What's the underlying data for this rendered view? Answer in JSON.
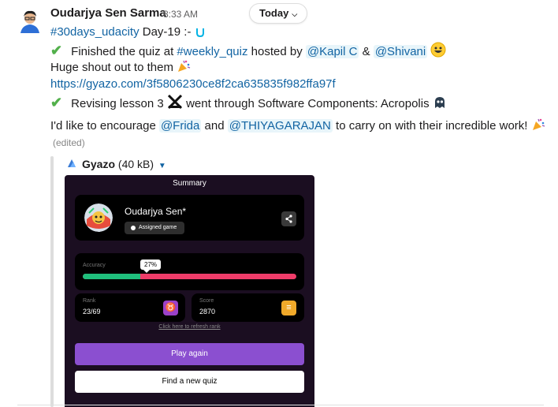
{
  "message": {
    "sender": "Oudarjya Sen Sarma",
    "time": "8:33 AM",
    "date_divider": "Today",
    "line1": {
      "channel": "#30days_udacity",
      "text": " Day-19  :-"
    },
    "line2": {
      "prefix": "Finished the quiz at ",
      "channel": "#weekly_quiz",
      "mid": "  hosted by ",
      "mention1": "@Kapil C",
      "amp": " & ",
      "mention2": "@Shivani"
    },
    "line3": "Huge shout out to them",
    "link": "https://gyazo.com/3f5806230ce8f2ca635835f982ffa97f",
    "line5": {
      "prefix": "Revising lesson 3 ",
      "suffix": " went through Software Components: Acropolis "
    },
    "line6": {
      "prefix": "I'd like to encourage ",
      "mention1": "@Frida",
      "mid": " and ",
      "mention2": "@THIYAGARAJAN",
      "suffix": " to carry on with their incredible work!"
    },
    "edited": "(edited)"
  },
  "attachment": {
    "source": "Gyazo",
    "size": "(40 kB)"
  },
  "quiz": {
    "title": "Summary",
    "player": "Oudarjya Sen*",
    "badge": "Assigned game",
    "accuracy_label": "Accuracy",
    "accuracy_pct": 27,
    "accuracy_text": "27%",
    "rank_label": "Rank",
    "rank_value": "23/69",
    "score_label": "Score",
    "score_value": "2870",
    "refresh_link": "Click here to refresh rank",
    "play_again": "Play again",
    "find_quiz": "Find a new quiz"
  },
  "colors": {
    "link": "#1264a3",
    "check": "#52b04b",
    "play_button": "#8b4fd0",
    "accuracy_correct": "#1fbf7c",
    "accuracy_wrong": "#ef3c69"
  },
  "icons": [
    "check-icon",
    "udacity-icon",
    "smile-emoji",
    "party-popper-emoji",
    "acropolis-icon",
    "ghost-emoji",
    "gyazo-icon",
    "share-icon",
    "rank-icon",
    "score-icon",
    "chevron-down-icon"
  ]
}
